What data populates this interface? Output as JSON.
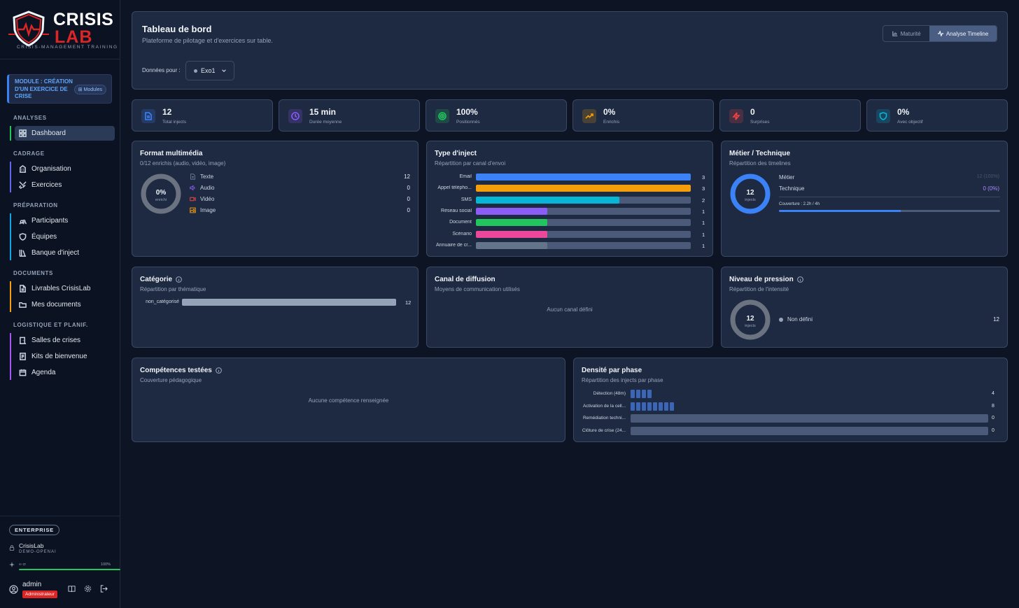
{
  "sidebar": {
    "logo": {
      "word1": "CRISIS",
      "word2": "LAB",
      "tagline": "CRISIS-MANAGEMENT TRAINING"
    },
    "module": {
      "label": "MODULE : CRÉATION D'UN EXERCICE DE CRISE",
      "chip": "Modules"
    },
    "sections": [
      {
        "title": "ANALYSES",
        "color": "#22c55e",
        "items": [
          {
            "label": "Dashboard",
            "icon": "grid-icon",
            "active": true
          }
        ]
      },
      {
        "title": "CADRAGE",
        "color": "#6366f1",
        "items": [
          {
            "label": "Organisation",
            "icon": "building-icon"
          },
          {
            "label": "Exercices",
            "icon": "swords-icon"
          }
        ]
      },
      {
        "title": "PRÉPARATION",
        "color": "#0ea5e9",
        "items": [
          {
            "label": "Participants",
            "icon": "users-icon"
          },
          {
            "label": "Équipes",
            "icon": "shield-icon"
          },
          {
            "label": "Banque d'inject",
            "icon": "library-icon"
          }
        ]
      },
      {
        "title": "DOCUMENTS",
        "color": "#f59e0b",
        "items": [
          {
            "label": "Livrables CrisisLab",
            "icon": "file-icon"
          },
          {
            "label": "Mes documents",
            "icon": "folder-icon"
          }
        ]
      },
      {
        "title": "LOGISTIQUE ET PLANIF.",
        "color": "#a855f7",
        "items": [
          {
            "label": "Salles de crises",
            "icon": "door-icon"
          },
          {
            "label": "Kits de bienvenue",
            "icon": "kit-icon"
          },
          {
            "label": "Agenda",
            "icon": "calendar-icon"
          }
        ]
      }
    ],
    "plan": "ENTERPRISE",
    "org": {
      "name": "CrisisLab",
      "sub": "DEMO-OPENAI"
    },
    "quota": {
      "label": "∞ cr",
      "pct": "100%",
      "fraction": 1.0
    },
    "user": {
      "name": "admin",
      "role": "Administrateur"
    }
  },
  "header": {
    "title": "Tableau de bord",
    "subtitle": "Plateforme de pilotage et d'exercices sur table.",
    "toggle": [
      {
        "label": "Maturité",
        "active": false
      },
      {
        "label": "Analyse Timeline",
        "active": true
      }
    ],
    "data_for_label": "Données pour :",
    "selected_exercise": "Exo1"
  },
  "stats": [
    {
      "value": "12",
      "label": "Total injects",
      "icon": "document-icon",
      "color": "#3b82f6"
    },
    {
      "value": "15 min",
      "label": "Durée moyenne",
      "icon": "clock-icon",
      "color": "#8b5cf6"
    },
    {
      "value": "100%",
      "label": "Positionnés",
      "icon": "target-icon",
      "color": "#22c55e"
    },
    {
      "value": "0%",
      "label": "Enrichis",
      "icon": "trend-icon",
      "color": "#f59e0b"
    },
    {
      "value": "0",
      "label": "Surprises",
      "icon": "bolt-icon",
      "color": "#ef4444"
    },
    {
      "value": "0%",
      "label": "Avec objectif",
      "icon": "shield-icon",
      "color": "#06b6d4"
    }
  ],
  "format": {
    "title": "Format multimédia",
    "subtitle": "0/12 enrichis (audio, vidéo, image)",
    "donut_value": "0%",
    "donut_label": "enrichi",
    "donut_fraction": 0,
    "rows": [
      {
        "label": "Texte",
        "value": "12",
        "icon": "text-icon",
        "color": "#64748b"
      },
      {
        "label": "Audio",
        "value": "0",
        "icon": "audio-icon",
        "color": "#8b5cf6"
      },
      {
        "label": "Vidéo",
        "value": "0",
        "icon": "video-icon",
        "color": "#ef4444"
      },
      {
        "label": "Image",
        "value": "0",
        "icon": "image-icon",
        "color": "#f59e0b"
      }
    ]
  },
  "inject_type": {
    "title": "Type d'inject",
    "subtitle": "Répartition par canal d'envoi",
    "max": 3,
    "rows": [
      {
        "label": "Email",
        "value": 3,
        "color": "#3b82f6"
      },
      {
        "label": "Appel télépho...",
        "value": 3,
        "color": "#f59e0b"
      },
      {
        "label": "SMS",
        "value": 2,
        "color": "#06b6d4"
      },
      {
        "label": "Réseau social",
        "value": 1,
        "color": "#8b5cf6"
      },
      {
        "label": "Document",
        "value": 1,
        "color": "#22c55e"
      },
      {
        "label": "Scénario",
        "value": 1,
        "color": "#ec4899"
      },
      {
        "label": "Annuaire de cr...",
        "value": 1,
        "color": "#64748b"
      }
    ]
  },
  "metier": {
    "title": "Métier / Technique",
    "subtitle": "Répartition des timelines",
    "donut_value": "12",
    "donut_label": "injects",
    "metier_fraction": 1.0,
    "rows": [
      {
        "label": "Métier",
        "value": "12 (100%)"
      },
      {
        "label": "Technique",
        "value": "0 (0%)"
      }
    ],
    "coverage_label": "Couverture : 2.2h / 4h",
    "coverage_fraction": 0.55
  },
  "categorie": {
    "title": "Catégorie",
    "subtitle": "Répartition par thématique",
    "rows": [
      {
        "label": "non_catégorisé",
        "value": "12",
        "fraction": 1.0
      }
    ]
  },
  "canal": {
    "title": "Canal de diffusion",
    "subtitle": "Moyens de communication utilisés",
    "empty": "Aucun canal défini"
  },
  "pression": {
    "title": "Niveau de pression",
    "subtitle": "Répartition de l'intensité",
    "donut_value": "12",
    "donut_label": "injects",
    "rows": [
      {
        "label": "Non défini",
        "value": "12"
      }
    ]
  },
  "competences": {
    "title": "Compétences testées",
    "subtitle": "Couverture pédagogique",
    "empty": "Aucune compétence renseignée"
  },
  "densite": {
    "title": "Densité par phase",
    "subtitle": "Répartition des injects par phase",
    "rows": [
      {
        "label": "Détection (48m)",
        "value": 4
      },
      {
        "label": "Activation de la cell...",
        "value": 8
      },
      {
        "label": "Remédiation techni...",
        "value": 0
      },
      {
        "label": "Clôture de crise (24...",
        "value": 0
      }
    ]
  }
}
